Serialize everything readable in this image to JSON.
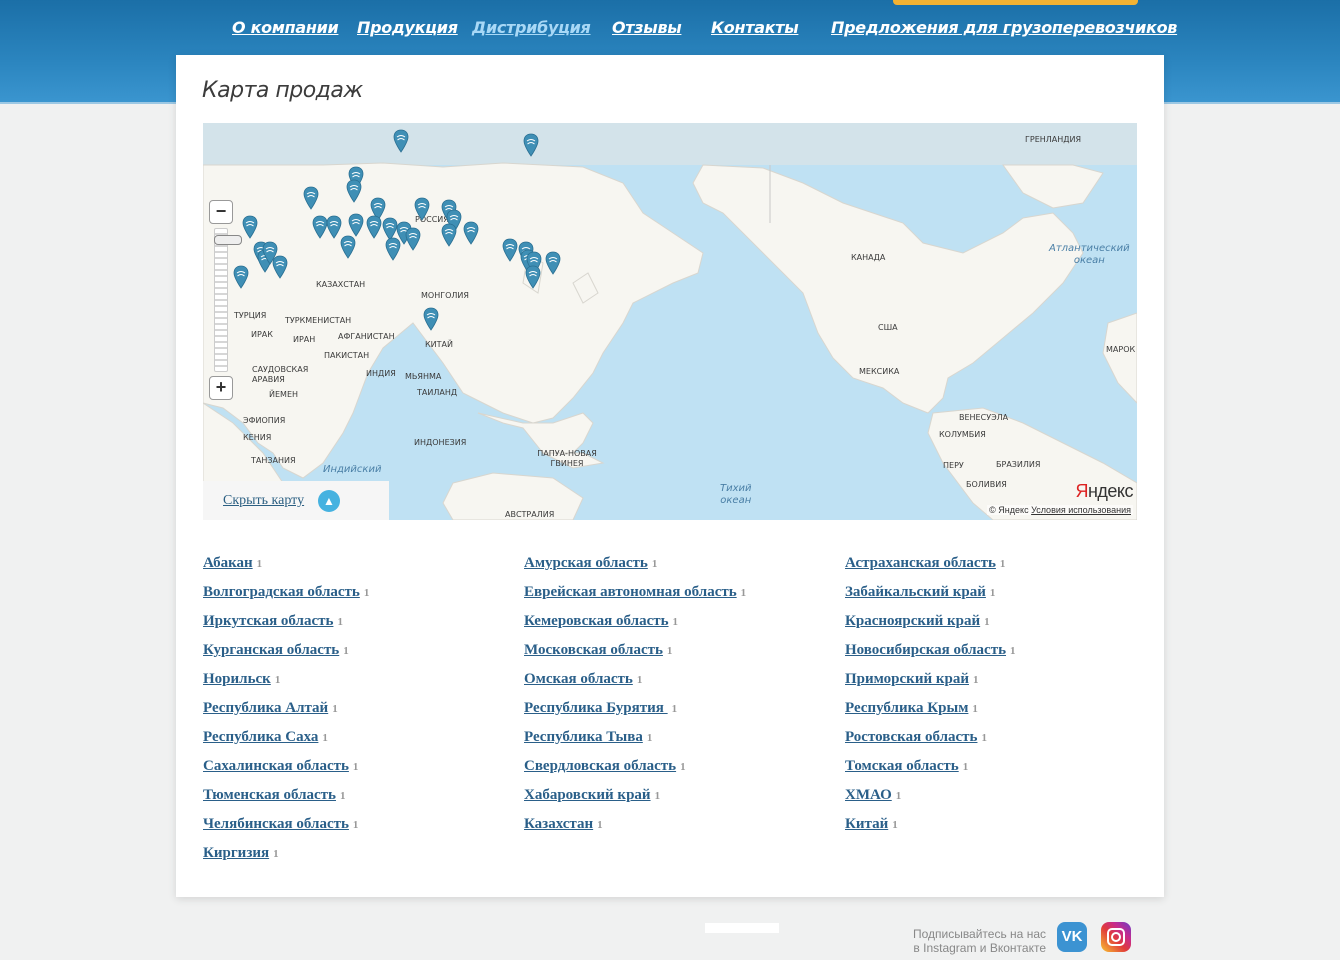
{
  "nav": {
    "items": [
      {
        "label": "О компании",
        "active": false
      },
      {
        "label": "Продукция",
        "active": false
      },
      {
        "label": "Дистрибуция",
        "active": true
      },
      {
        "label": "Отзывы",
        "active": false
      },
      {
        "label": "Контакты",
        "active": false
      },
      {
        "label": "Предложения для грузоперевозчиков",
        "active": false
      }
    ]
  },
  "page": {
    "title": "Карта продаж"
  },
  "map": {
    "country_labels": [
      "ГРЕНЛАНДИЯ",
      "РОССИЯ",
      "КАНАДА",
      "КАЗАХСТАН",
      "МОНГОЛИЯ",
      "ТУРЦИЯ",
      "ТУРКМЕНИСТАН",
      "ИРАК",
      "ИРАН",
      "АФГАНИСТАН",
      "ПАКИСТАН",
      "КИТАЙ",
      "САУДОВСКАЯ АРАВИЯ",
      "ИНДИЯ",
      "МЬЯНМА",
      "ЙЕМЕН",
      "ТАИЛАНД",
      "ЭФИОПИЯ",
      "КЕНИЯ",
      "ТАНЗАНИЯ",
      "ИНДОНЕЗИЯ",
      "ПАПУА-НОВАЯ ГВИНЕЯ",
      "АВСТРАЛИЯ",
      "США",
      "МЕКСИКА",
      "ВЕНЕСУЭЛА",
      "КОЛУМБИЯ",
      "ПЕРУ",
      "БРАЗИЛИЯ",
      "БОЛИВИЯ",
      "МАРОК"
    ],
    "ocean_labels": [
      "Атлантический\nокеан",
      "Индийский",
      "Тихий\nокеан"
    ],
    "hide_label": "Скрыть карту",
    "logo": {
      "y": "Я",
      "rest": "ндекс"
    },
    "copyright": "© Яндекс",
    "terms": "Условия использования",
    "zoom_in": "+",
    "zoom_out": "−",
    "marker_color": "#3f8fb5"
  },
  "regions": {
    "columns": [
      [
        {
          "name": "Абакан",
          "count": "1"
        },
        {
          "name": "Волгоградская область",
          "count": "1"
        },
        {
          "name": "Иркутская область",
          "count": "1"
        },
        {
          "name": "Курганская область",
          "count": "1"
        },
        {
          "name": "Норильск",
          "count": "1"
        },
        {
          "name": "Республика Алтай",
          "count": "1"
        },
        {
          "name": "Республика Саха",
          "count": "1"
        },
        {
          "name": "Сахалинская область",
          "count": "1"
        },
        {
          "name": "Тюменская область",
          "count": "1"
        },
        {
          "name": "Челябинская область",
          "count": "1"
        },
        {
          "name": "Киргизия",
          "count": "1"
        }
      ],
      [
        {
          "name": "Амурская область",
          "count": "1"
        },
        {
          "name": "Еврейская автономная область",
          "count": "1"
        },
        {
          "name": "Кемеровская область",
          "count": "1"
        },
        {
          "name": "Московская область",
          "count": "1"
        },
        {
          "name": "Омская область",
          "count": "1"
        },
        {
          "name": "Республика Бурятия ",
          "count": "1"
        },
        {
          "name": "Республика Тыва",
          "count": "1"
        },
        {
          "name": "Свердловская область",
          "count": "1"
        },
        {
          "name": "Хабаровский край",
          "count": "1"
        },
        {
          "name": "Казахстан",
          "count": "1"
        }
      ],
      [
        {
          "name": "Астраханская область",
          "count": "1"
        },
        {
          "name": "Забайкальский край",
          "count": "1"
        },
        {
          "name": "Красноярский край",
          "count": "1"
        },
        {
          "name": "Новосибирская область",
          "count": "1"
        },
        {
          "name": "Приморский край",
          "count": "1"
        },
        {
          "name": "Республика Крым",
          "count": "1"
        },
        {
          "name": "Ростовская область",
          "count": "1"
        },
        {
          "name": "Томская область",
          "count": "1"
        },
        {
          "name": "ХМАО",
          "count": "1"
        },
        {
          "name": "Китай",
          "count": "1"
        }
      ]
    ]
  },
  "footer": {
    "subscribe_text": "Подписывайтесь на нас\nв Instagram и Вконтакте",
    "vk_label": "VK"
  }
}
